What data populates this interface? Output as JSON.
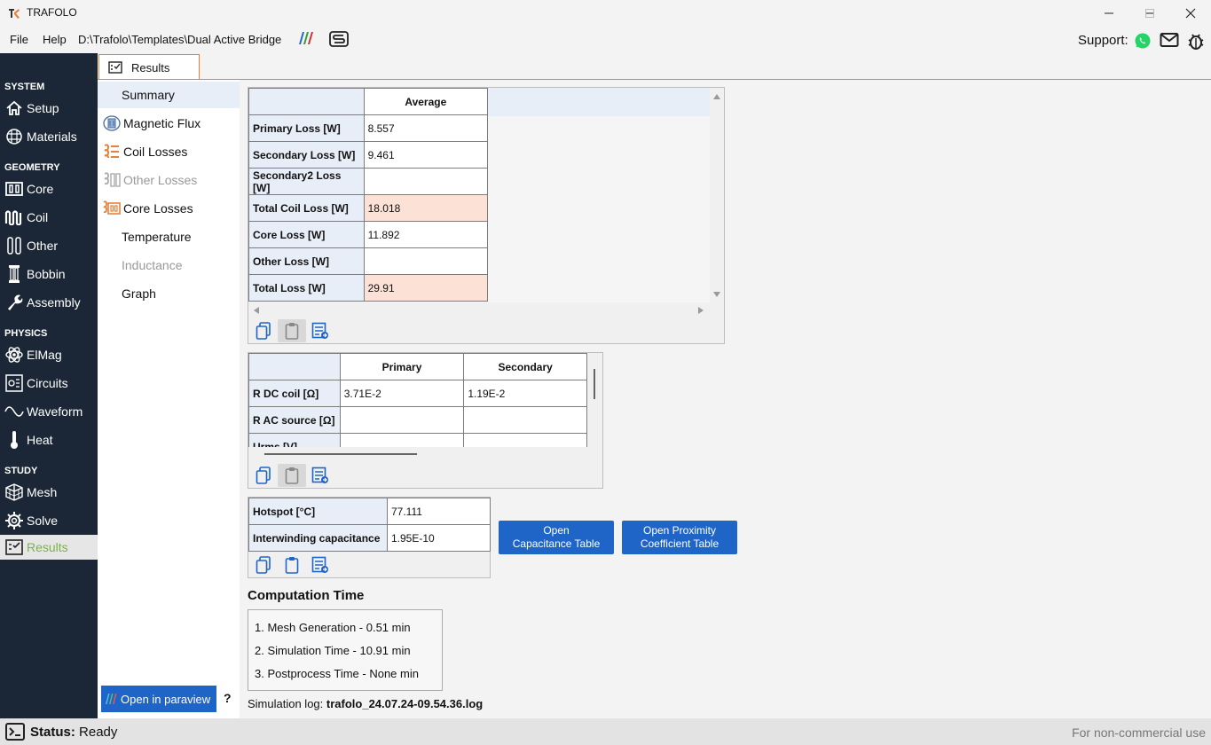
{
  "window": {
    "title": "TRAFOLO"
  },
  "menu": {
    "file": "File",
    "help": "Help",
    "path": "D:\\Trafolo\\Templates\\Dual Active Bridge",
    "support": "Support:"
  },
  "sidebar": {
    "sections": [
      "SYSTEM",
      "GEOMETRY",
      "PHYSICS",
      "STUDY"
    ],
    "items": [
      "Setup",
      "Materials",
      "Core",
      "Coil",
      "Other",
      "Bobbin",
      "Assembly",
      "ElMag",
      "Circuits",
      "Waveform",
      "Heat",
      "Mesh",
      "Solve",
      "Results"
    ]
  },
  "tab": {
    "label": "Results"
  },
  "subnav": [
    "Summary",
    "Magnetic Flux",
    "Coil Losses",
    "Other Losses",
    "Core Losses",
    "Temperature",
    "Inductance",
    "Graph"
  ],
  "loss_table": {
    "header": "Average",
    "rows": [
      {
        "label": "Primary Loss [W]",
        "value": "8.557"
      },
      {
        "label": "Secondary Loss [W]",
        "value": "9.461"
      },
      {
        "label": "Secondary2 Loss [W]",
        "value": ""
      },
      {
        "label": "Total Coil Loss [W]",
        "value": "18.018"
      },
      {
        "label": "Core Loss [W]",
        "value": "11.892"
      },
      {
        "label": "Other Loss [W]",
        "value": ""
      },
      {
        "label": "Total Loss [W]",
        "value": "29.91"
      }
    ]
  },
  "coil_table": {
    "headers": [
      "Primary",
      "Secondary"
    ],
    "rows": [
      {
        "label": "R DC coil [Ω]",
        "values": [
          "3.71E-2",
          "1.19E-2"
        ]
      },
      {
        "label": "R AC source [Ω]",
        "values": [
          "",
          ""
        ]
      },
      {
        "label": "Urms [V]",
        "values": [
          "",
          ""
        ]
      }
    ]
  },
  "misc_table": {
    "rows": [
      {
        "label": "Hotspot [°C]",
        "value": "77.111"
      },
      {
        "label": "Interwinding capacitance",
        "value": "1.95E-10"
      }
    ]
  },
  "buttons": {
    "capacitance": "Open Capacitance Table",
    "capacitance_l1": "Open",
    "capacitance_l2": "Capacitance Table",
    "proximity_l1": "Open Proximity",
    "proximity_l2": "Coefficient Table",
    "paraview": "Open in paraview",
    "help": "?"
  },
  "computation": {
    "title": "Computation Time",
    "lines": [
      "1. Mesh Generation -  0.51 min",
      "2. Simulation Time -  10.91 min",
      "3. Postprocess Time -  None min"
    ]
  },
  "simlog": {
    "label": "Simulation log:",
    "file": "trafolo_24.07.24-09.54.36.log"
  },
  "status": {
    "label": "Status:",
    "value": "Ready",
    "right": "For non-commercial use"
  },
  "colors": {
    "sidebar_bg": "#1b2736",
    "accent_orange": "#e8803a",
    "button_blue": "#1f65c8",
    "highlight_cell": "#fbe1d6",
    "active_green": "#7cb342"
  }
}
